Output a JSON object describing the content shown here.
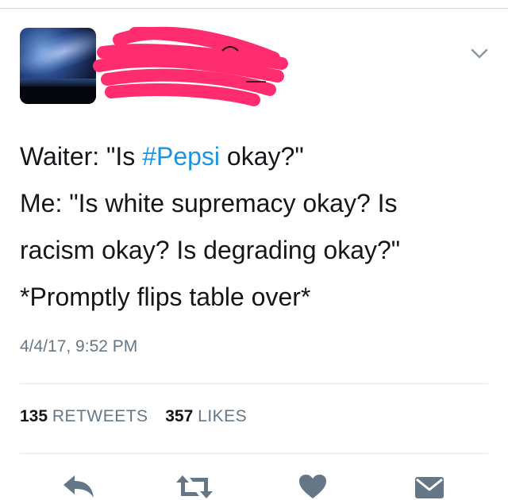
{
  "tweet": {
    "text_line1_prefix": "Waiter: \"Is ",
    "hashtag": "#Pepsi",
    "text_line1_suffix": " okay?\"",
    "text_line2": "Me: \"Is white supremacy okay? Is",
    "text_line3": "racism okay? Is degrading okay?\"",
    "text_line4": "*Promptly flips table over*",
    "timestamp": "4/4/17, 9:52 PM"
  },
  "stats": {
    "retweets_count": "135",
    "retweets_label": "RETWEETS",
    "likes_count": "357",
    "likes_label": "LIKES"
  },
  "icons": {
    "more": "chevron-down-icon",
    "reply": "reply-icon",
    "retweet": "retweet-icon",
    "like": "heart-icon",
    "message": "envelope-icon"
  },
  "colors": {
    "hashtag": "#1b95e0",
    "icon_gray": "#657786",
    "redaction": "#ff2d6f"
  }
}
